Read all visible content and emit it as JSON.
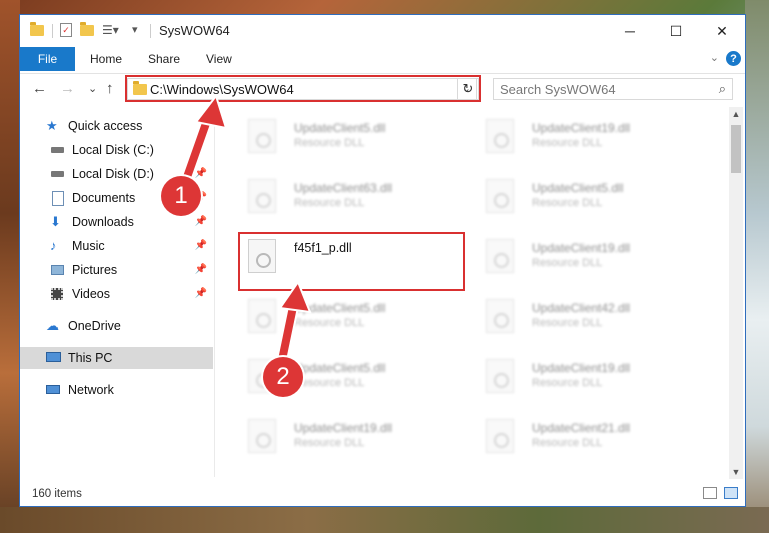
{
  "window": {
    "title": "SysWOW64",
    "minimize": "─",
    "maximize": "☐",
    "close": "✕"
  },
  "ribbon": {
    "file": "File",
    "home": "Home",
    "share": "Share",
    "view": "View",
    "help": "?"
  },
  "nav": {
    "back": "←",
    "forward": "→",
    "recent": "⌄",
    "up": "↑",
    "address": "C:\\Windows\\SysWOW64",
    "refresh": "↻",
    "search_placeholder": "Search SysWOW64"
  },
  "sidebar": {
    "items": [
      {
        "label": "Quick access",
        "icon": "star-icon"
      },
      {
        "label": "Local Disk (C:)",
        "icon": "drive-icon"
      },
      {
        "label": "Local Disk (D:)",
        "icon": "drive-icon"
      },
      {
        "label": "Documents",
        "icon": "documents-icon"
      },
      {
        "label": "Downloads",
        "icon": "downloads-icon"
      },
      {
        "label": "Music",
        "icon": "music-icon"
      },
      {
        "label": "Pictures",
        "icon": "pictures-icon"
      },
      {
        "label": "Videos",
        "icon": "videos-icon"
      },
      {
        "label": "OneDrive",
        "icon": "cloud-icon"
      },
      {
        "label": "This PC",
        "icon": "computer-icon"
      },
      {
        "label": "Network",
        "icon": "network-icon"
      }
    ]
  },
  "files": [
    {
      "name": "UpdateClient5.dll",
      "desc": "Resource DLL"
    },
    {
      "name": "UpdateClient19.dll",
      "desc": "Resource DLL"
    },
    {
      "name": "UpdateClient63.dll",
      "desc": "Resource DLL"
    },
    {
      "name": "UpdateClient5.dll",
      "desc": "Resource DLL"
    },
    {
      "name": "f45f1_p.dll",
      "desc": ""
    },
    {
      "name": "UpdateClient19.dll",
      "desc": "Resource DLL"
    },
    {
      "name": "UpdateClient5.dll",
      "desc": "Resource DLL"
    },
    {
      "name": "UpdateClient42.dll",
      "desc": "Resource DLL"
    },
    {
      "name": "UpdateClient5.dll",
      "desc": "Resource DLL"
    },
    {
      "name": "UpdateClient19.dll",
      "desc": "Resource DLL"
    },
    {
      "name": "UpdateClient19.dll",
      "desc": "Resource DLL"
    },
    {
      "name": "UpdateClient21.dll",
      "desc": "Resource DLL"
    }
  ],
  "status": {
    "count": "160 items"
  },
  "annotations": {
    "step1": "1",
    "step2": "2"
  },
  "colors": {
    "accent": "#1979ca",
    "highlight": "#d93030"
  }
}
